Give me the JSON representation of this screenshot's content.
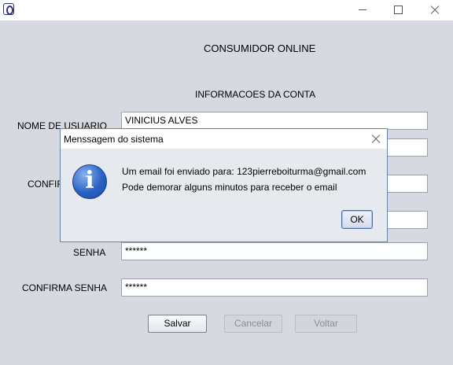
{
  "window": {
    "title": "",
    "icon": "java-app-icon",
    "controls": [
      "minimize",
      "maximize",
      "close"
    ]
  },
  "form": {
    "title": "CONSUMIDOR ONLINE",
    "section_title": "INFORMACOES DA CONTA",
    "username_label": "NOME DE USUARIO",
    "username_value": "VINICIUS ALVES",
    "confirm_label_partial": "CONFIR",
    "senha_label": "SENHA",
    "senha_value": "******",
    "confirma_senha_label": "CONFIRMA SENHA",
    "confirma_senha_value": "******",
    "buttons": {
      "save": "Salvar",
      "cancel": "Cancelar",
      "back": "Voltar"
    }
  },
  "dialog": {
    "title": "Menssagem do sistema",
    "icon": "information-icon",
    "line1": "Um email foi enviado para: 123pierreboiturma@gmail.com",
    "line2": "Pode demorar alguns minutos para receber o email",
    "ok_label": "OK"
  }
}
